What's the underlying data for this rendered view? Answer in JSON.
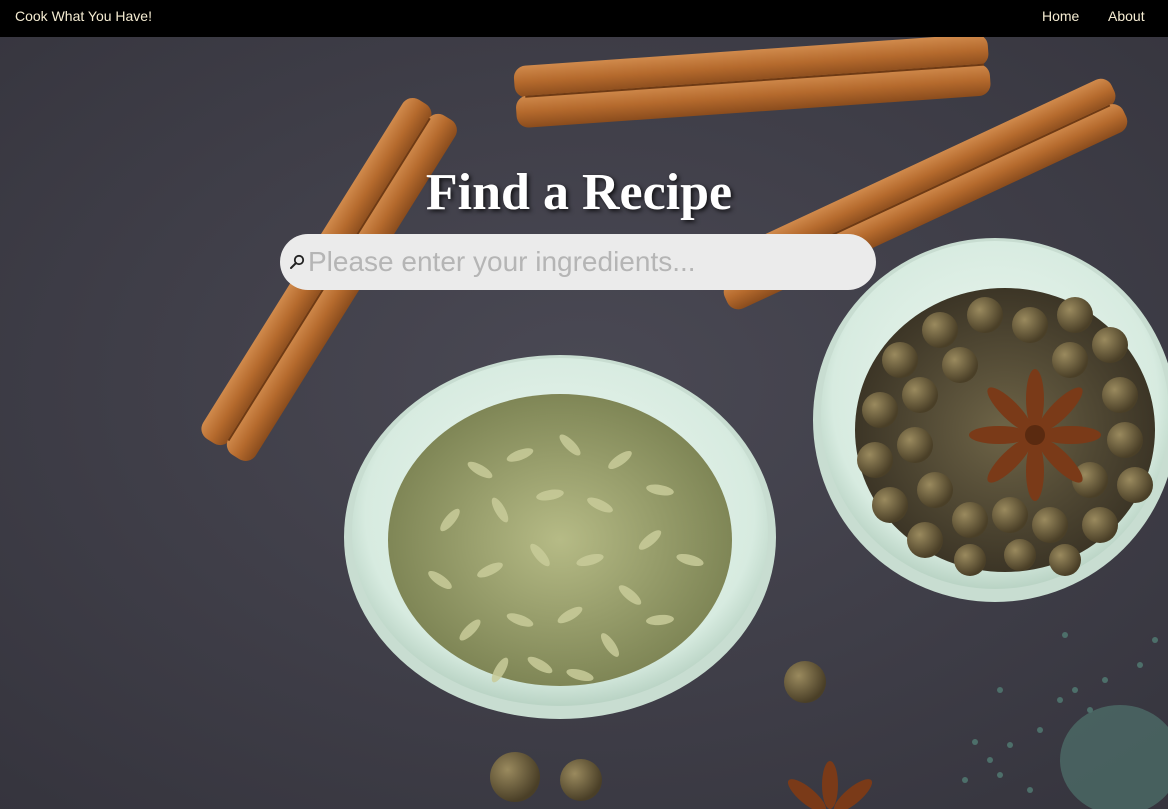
{
  "navbar": {
    "brand": "Cook What You Have!",
    "links": [
      {
        "label": "Home"
      },
      {
        "label": "About"
      }
    ]
  },
  "hero": {
    "title": "Find a Recipe",
    "search": {
      "placeholder": "Please enter your ingredients...",
      "value": "",
      "icon": "search-icon"
    }
  },
  "colors": {
    "navbar_bg": "#000000",
    "nav_text": "#f5ecd2",
    "search_bg": "#ebebeb",
    "placeholder": "#b5b5b5",
    "background": "#3f3e48"
  }
}
